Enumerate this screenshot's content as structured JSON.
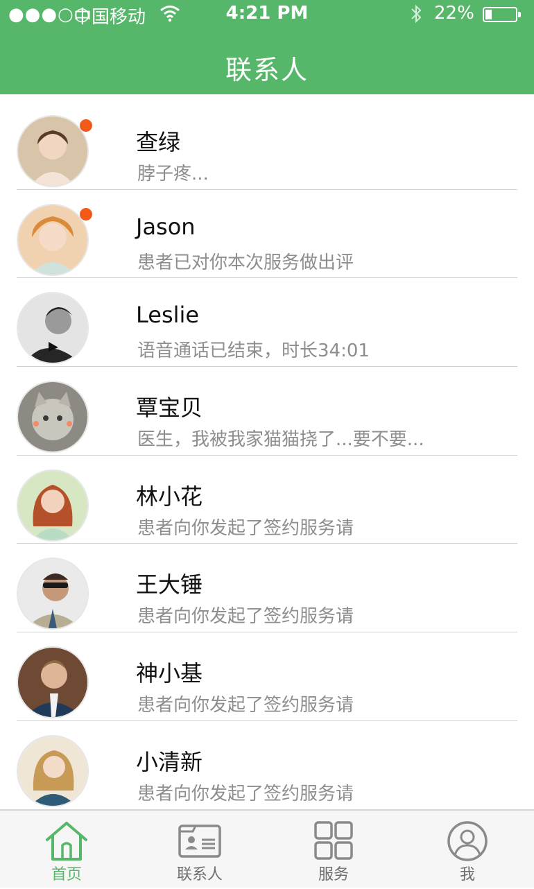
{
  "status_bar": {
    "signal": "●●●○○",
    "carrier": "中国移动",
    "time": "4:21 PM",
    "battery": "22%",
    "battery_level": 0.22
  },
  "header": {
    "title": "联系人"
  },
  "contacts": [
    {
      "name": "查绿",
      "message": "脖子疼...",
      "unread": true
    },
    {
      "name": "Jason",
      "message": "患者已对你本次服务做出评",
      "unread": true
    },
    {
      "name": "Leslie",
      "message": "语音通话已结束，时长34:01",
      "unread": false
    },
    {
      "name": "覃宝贝",
      "message": "医生，我被我家猫猫挠了...要不要...",
      "unread": false
    },
    {
      "name": "林小花",
      "message": "患者向你发起了签约服务请",
      "unread": false
    },
    {
      "name": "王大锤",
      "message": "患者向你发起了签约服务请",
      "unread": false
    },
    {
      "name": "神小基",
      "message": "患者向你发起了签约服务请",
      "unread": false
    },
    {
      "name": "小清新",
      "message": "患者向你发起了签约服务请",
      "unread": false
    }
  ],
  "tabbar": {
    "tabs": [
      {
        "label": "首页",
        "icon": "home-icon",
        "active": true
      },
      {
        "label": "联系人",
        "icon": "contact-card-icon",
        "active": false
      },
      {
        "label": "服务",
        "icon": "grid-icon",
        "active": false
      },
      {
        "label": "我",
        "icon": "user-icon",
        "active": false
      }
    ]
  },
  "colors": {
    "accent": "#56b76a",
    "unread_dot": "#f25a1a"
  }
}
